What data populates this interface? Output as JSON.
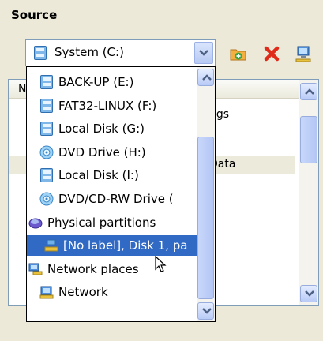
{
  "group": {
    "title": "Source"
  },
  "combo": {
    "selected": "System (C:)"
  },
  "list": {
    "header_col": "N",
    "rows_partial": [
      "ngs",
      "Data"
    ]
  },
  "dropdown": {
    "items": [
      {
        "label": "BACK-UP (E:)",
        "icon": "drive-icon"
      },
      {
        "label": "FAT32-LINUX (F:)",
        "icon": "drive-icon"
      },
      {
        "label": "Local Disk (G:)",
        "icon": "drive-icon"
      },
      {
        "label": "DVD Drive (H:)",
        "icon": "dvd-icon"
      },
      {
        "label": "Local Disk (I:)",
        "icon": "drive-icon"
      },
      {
        "label": "DVD/CD-RW Drive (",
        "icon": "dvd-icon"
      },
      {
        "label": "Physical partitions",
        "icon": "partitions-icon"
      },
      {
        "label": "[No label], Disk 1, pa",
        "icon": "partition-icon",
        "selected": true
      },
      {
        "label": "Network places",
        "icon": "network-places-icon"
      },
      {
        "label": "Network",
        "icon": "network-icon"
      }
    ]
  },
  "colors": {
    "selection": "#316ac5",
    "window_bg": "#ece9d8",
    "border": "#7f9db9"
  }
}
